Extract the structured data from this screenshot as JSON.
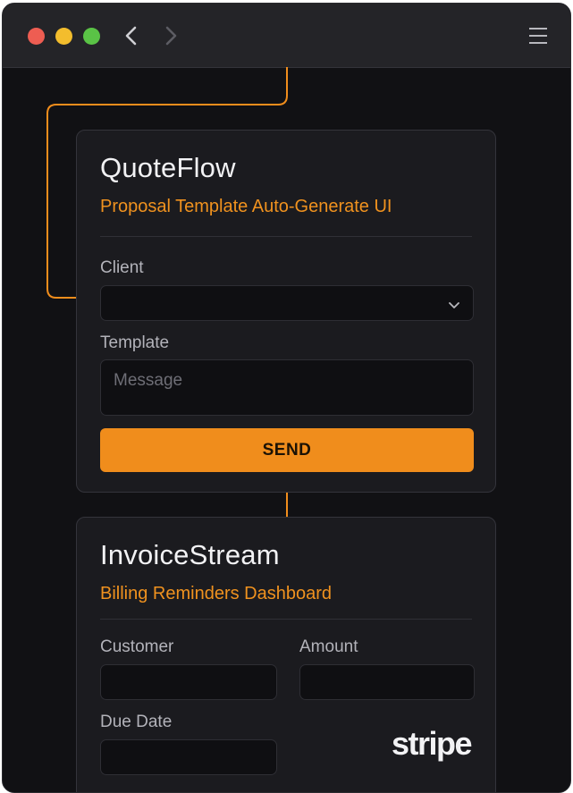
{
  "toolbar": {
    "back_icon": "chevron-left-icon",
    "forward_icon": "chevron-right-icon",
    "menu_icon": "hamburger-menu-icon"
  },
  "quoteflow": {
    "title": "QuoteFlow",
    "subtitle": "Proposal Template Auto-Generate UI",
    "client_label": "Client",
    "client_value": "",
    "template_label": "Template",
    "template_placeholder": "Message",
    "send_label": "SEND"
  },
  "invoicestream": {
    "title": "InvoiceStream",
    "subtitle": "Billing Reminders Dashboard",
    "customer_label": "Customer",
    "amount_label": "Amount",
    "due_date_label": "Due Date",
    "logo_text": "stripe"
  },
  "colors": {
    "accent": "#f08d1c",
    "background": "#111114",
    "card": "#1b1b1f"
  }
}
